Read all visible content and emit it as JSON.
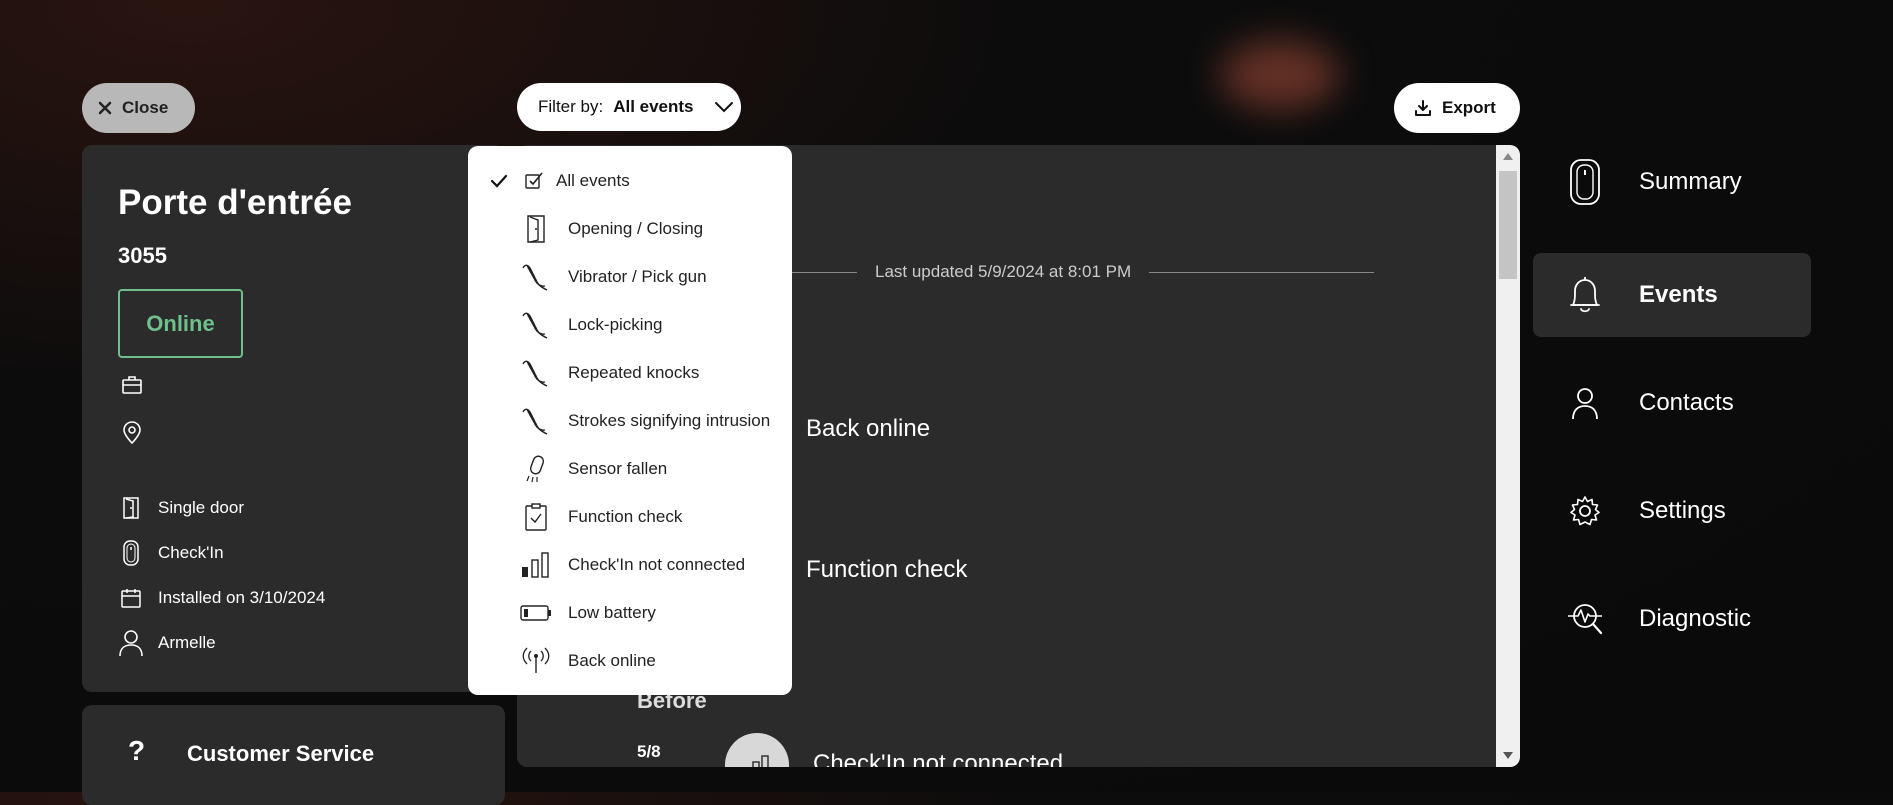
{
  "toolbar": {
    "close_label": "Close",
    "filter_prefix": "Filter by:",
    "filter_value": "All events",
    "export_label": "Export"
  },
  "device": {
    "name": "Porte d'entrée",
    "code": "3055",
    "status": "Online",
    "status_color": "#6fc08a",
    "door_type": "Single door",
    "sensor": "Check'In",
    "installed": "Installed on 3/10/2024",
    "user": "Armelle"
  },
  "customer_service": {
    "icon": "?",
    "label": "Customer Service"
  },
  "timeline": {
    "last_updated": "Last updated 5/9/2024 at 8:01 PM",
    "events": [
      {
        "title": "Back online"
      },
      {
        "title": "Function check"
      }
    ],
    "before_label": "Before",
    "date": "5/8",
    "last_event": "Check'In not connected"
  },
  "filter_menu": {
    "items": [
      {
        "label": "All events",
        "icon": "all-events-icon",
        "selected": true
      },
      {
        "label": "Opening / Closing",
        "icon": "door-icon",
        "selected": false
      },
      {
        "label": "Vibrator / Pick gun",
        "icon": "pick-icon",
        "selected": false
      },
      {
        "label": "Lock-picking",
        "icon": "pick-icon",
        "selected": false
      },
      {
        "label": "Repeated knocks",
        "icon": "pick-icon",
        "selected": false
      },
      {
        "label": "Strokes signifying intrusion",
        "icon": "pick-icon",
        "selected": false
      },
      {
        "label": "Sensor fallen",
        "icon": "sensor-fallen-icon",
        "selected": false
      },
      {
        "label": "Function check",
        "icon": "clipboard-check-icon",
        "selected": false
      },
      {
        "label": "Check'In not connected",
        "icon": "signal-bars-icon",
        "selected": false
      },
      {
        "label": "Low battery",
        "icon": "battery-low-icon",
        "selected": false
      },
      {
        "label": "Back online",
        "icon": "antenna-icon",
        "selected": false
      }
    ]
  },
  "nav": {
    "items": [
      {
        "label": "Summary",
        "icon": "sensor-icon",
        "active": false
      },
      {
        "label": "Events",
        "icon": "bell-icon",
        "active": true
      },
      {
        "label": "Contacts",
        "icon": "person-icon",
        "active": false
      },
      {
        "label": "Settings",
        "icon": "gear-icon",
        "active": false
      },
      {
        "label": "Diagnostic",
        "icon": "diagnostic-icon",
        "active": false
      }
    ]
  }
}
